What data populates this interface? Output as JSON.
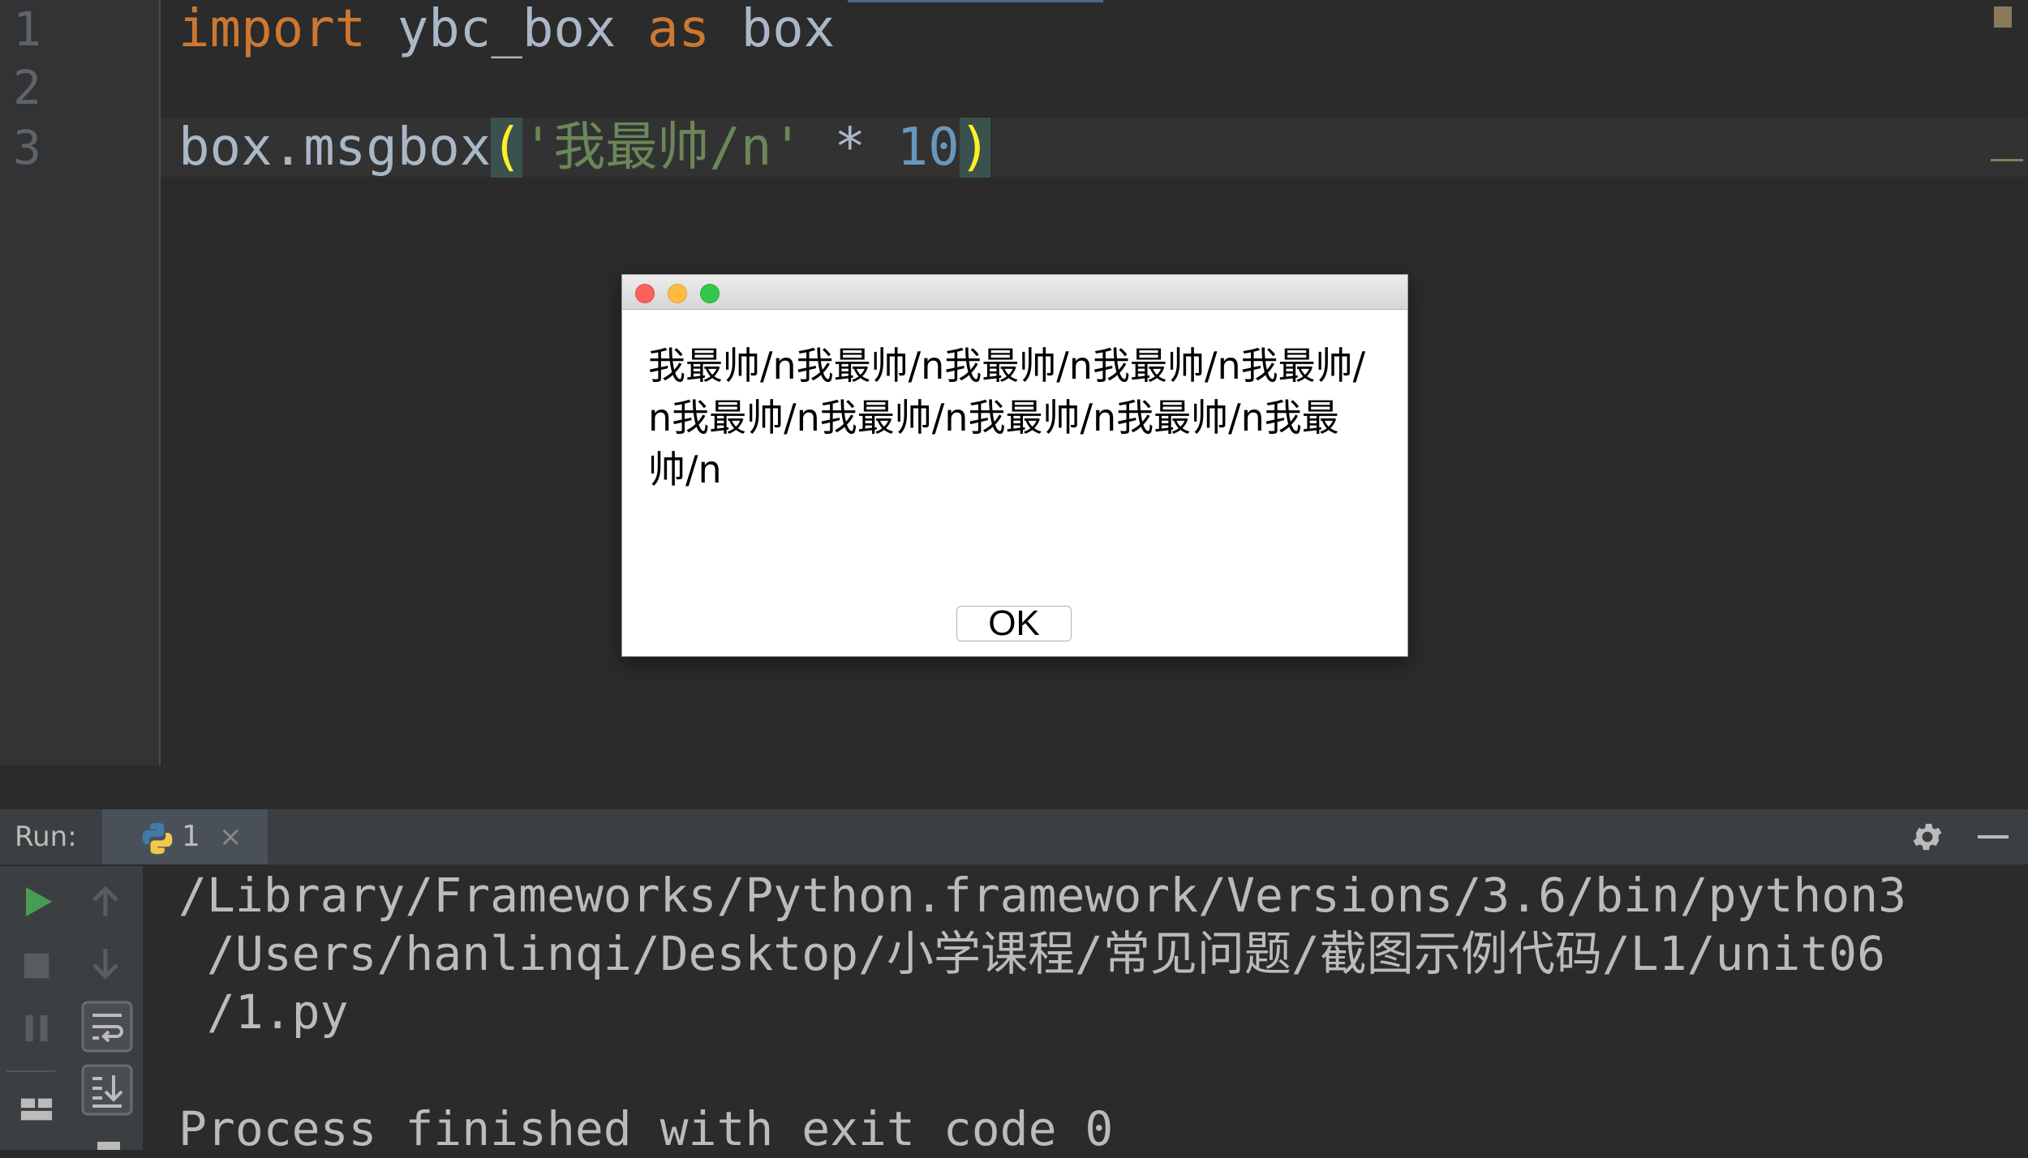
{
  "editor": {
    "line_numbers": [
      "1",
      "2",
      "3"
    ],
    "line1": {
      "keyword_import": "import",
      "module": "ybc_box",
      "keyword_as": "as",
      "alias": "box"
    },
    "line3": {
      "call": "box.msgbox",
      "open_paren": "(",
      "string": "'我最帅/n'",
      "operator": "*",
      "number": "10",
      "close_paren": ")"
    }
  },
  "dialog": {
    "message": "我最帅/n我最帅/n我最帅/n我最帅/n我最帅/n我最帅/n我最帅/n我最帅/n我最帅/n我最帅/n",
    "ok_label": "OK"
  },
  "run_panel": {
    "label": "Run:",
    "tab_label": "1",
    "tab_close": "×",
    "console_lines": [
      "/Library/Frameworks/Python.framework/Versions/3.6/bin/python3",
      " /Users/hanlinqi/Desktop/小学课程/常见问题/截图示例代码/L1/unit06",
      " /1.py",
      "",
      "Process finished with exit code 0"
    ]
  },
  "icons": {
    "run": "play-icon",
    "stop": "stop-icon",
    "pause": "pause-icon",
    "up": "arrow-up-icon",
    "down": "arrow-down-icon",
    "soft_wrap": "soft-wrap-icon",
    "scroll_end": "scroll-to-end-icon",
    "layout": "layout-icon",
    "settings": "gear-icon",
    "minimize": "minimize-icon",
    "python": "python-icon"
  },
  "colors": {
    "editor_bg": "#2b2b2b",
    "keyword": "#cc7832",
    "string": "#6a8759",
    "number": "#6897bb",
    "text": "#a9b7c6",
    "run_green": "#499c54"
  }
}
